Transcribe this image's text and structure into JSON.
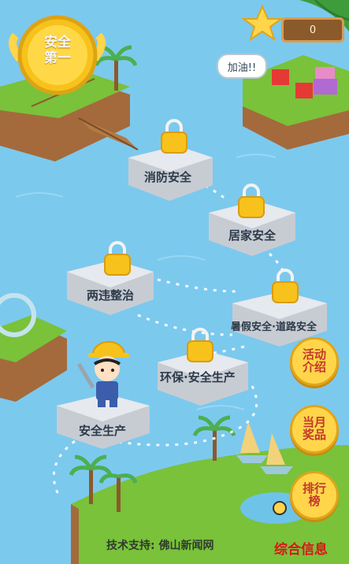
{
  "medal": {
    "text": "安全\n第一"
  },
  "score": {
    "value": "0"
  },
  "cheer": {
    "text": "加油!!"
  },
  "levels": [
    {
      "label": "消防安全"
    },
    {
      "label": "居家安全"
    },
    {
      "label": "两违整治"
    },
    {
      "label": "暑假安全·道路安全"
    },
    {
      "label": "环保·安全生产"
    },
    {
      "label": "安全生产"
    }
  ],
  "buttons": {
    "activity": "活动\n介绍",
    "monthly_prize": "当月\n奖品",
    "ranking": "排行\n榜"
  },
  "footer": {
    "support": "技术支持: 佛山新闻网"
  },
  "brand": {
    "text": "综合信息"
  },
  "colors": {
    "water": "#7cc9ee",
    "grass": "#79c23a",
    "button_fill": "#ffd54a",
    "button_text": "#c1392b",
    "lock": "#f7c21b",
    "brand": "#d9171a"
  }
}
